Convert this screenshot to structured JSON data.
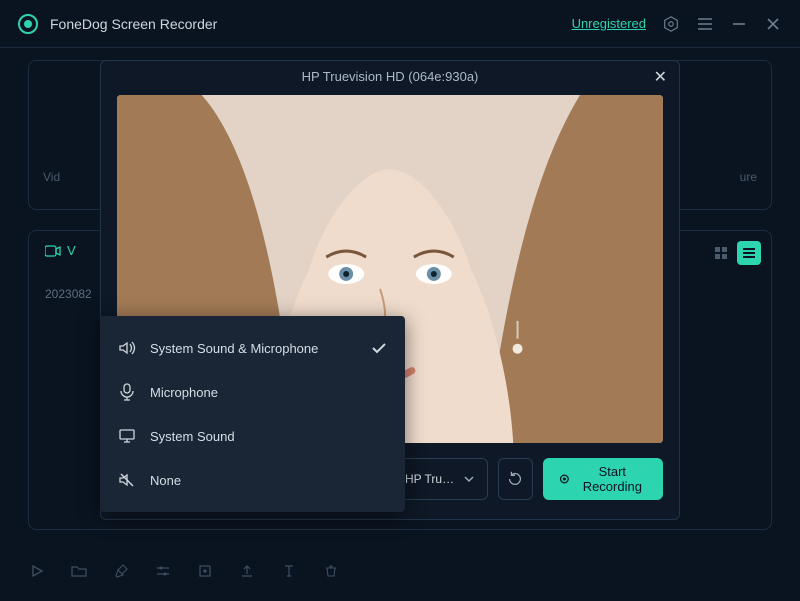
{
  "titlebar": {
    "app_name": "FoneDog Screen Recorder",
    "unregistered": "Unregistered"
  },
  "background": {
    "left_text": "Vid",
    "right_text": "ure",
    "tab_label": "V",
    "date": "2023082"
  },
  "modal": {
    "title": "HP Truevision HD (064e:930a)",
    "controls": {
      "audio_label": "System Sound & Microphone",
      "camera_label": "HP Truevi...",
      "start_label": "Start Recording"
    }
  },
  "audio_menu": {
    "items": [
      {
        "label": "System Sound & Microphone",
        "selected": true
      },
      {
        "label": "Microphone",
        "selected": false
      },
      {
        "label": "System Sound",
        "selected": false
      },
      {
        "label": "None",
        "selected": false
      }
    ]
  }
}
